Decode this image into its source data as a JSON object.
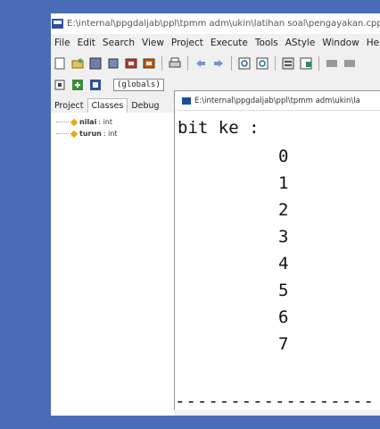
{
  "window": {
    "title": "E:\\internal\\ppgdaljab\\ppl\\tpmm adm\\ukin\\latihan soal\\pengayakan.cpp - [Ex"
  },
  "menu": [
    "File",
    "Edit",
    "Search",
    "View",
    "Project",
    "Execute",
    "Tools",
    "AStyle",
    "Window",
    "Hel"
  ],
  "scope_selector": "(globals)",
  "panel": {
    "tabs": [
      "Project",
      "Classes",
      "Debug"
    ],
    "active_tab": "Classes",
    "tree": [
      {
        "name": "nilai",
        "type": ": int"
      },
      {
        "name": "turun",
        "type": ": int"
      }
    ]
  },
  "console": {
    "title": "E:\\internal\\ppgdaljab\\ppl\\tpmm adm\\ukin\\la",
    "heading": "bit ke :",
    "bits": [
      "0",
      "1",
      "2",
      "3",
      "4",
      "5",
      "6",
      "7"
    ],
    "dashes": "------------------"
  }
}
